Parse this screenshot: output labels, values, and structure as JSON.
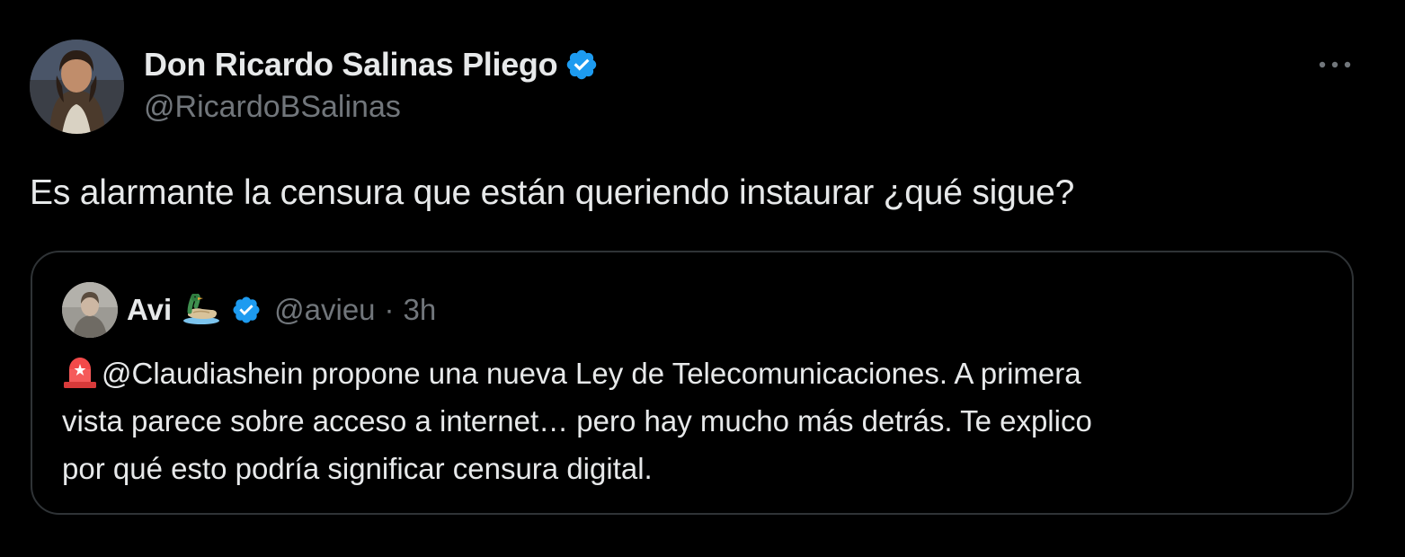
{
  "tweet": {
    "author": {
      "display_name": "Don Ricardo Salinas Pliego",
      "handle": "@RicardoBSalinas",
      "verified": true
    },
    "more_icon": "more-horizontal-icon",
    "text": "Es alarmante la censura que están queriendo instaurar ¿qué sigue?",
    "quoted": {
      "author": {
        "display_name": "Avi",
        "emoji": "duck-icon",
        "handle": "@avieu",
        "verified": true
      },
      "separator": "·",
      "time": "3h",
      "prefix_icon": "rotating-light-icon",
      "lines": [
        "@Claudiashein propone una nueva Ley de Telecomunicaciones. A primera",
        "vista parece sobre acceso a internet… pero hay mucho más detrás. Te explico",
        "por qué esto podría significar censura digital."
      ]
    }
  },
  "colors": {
    "background": "#000000",
    "text_primary": "#e7e9ea",
    "text_secondary": "#71767b",
    "verified_blue": "#1d9bf0",
    "border": "#2f3336"
  }
}
